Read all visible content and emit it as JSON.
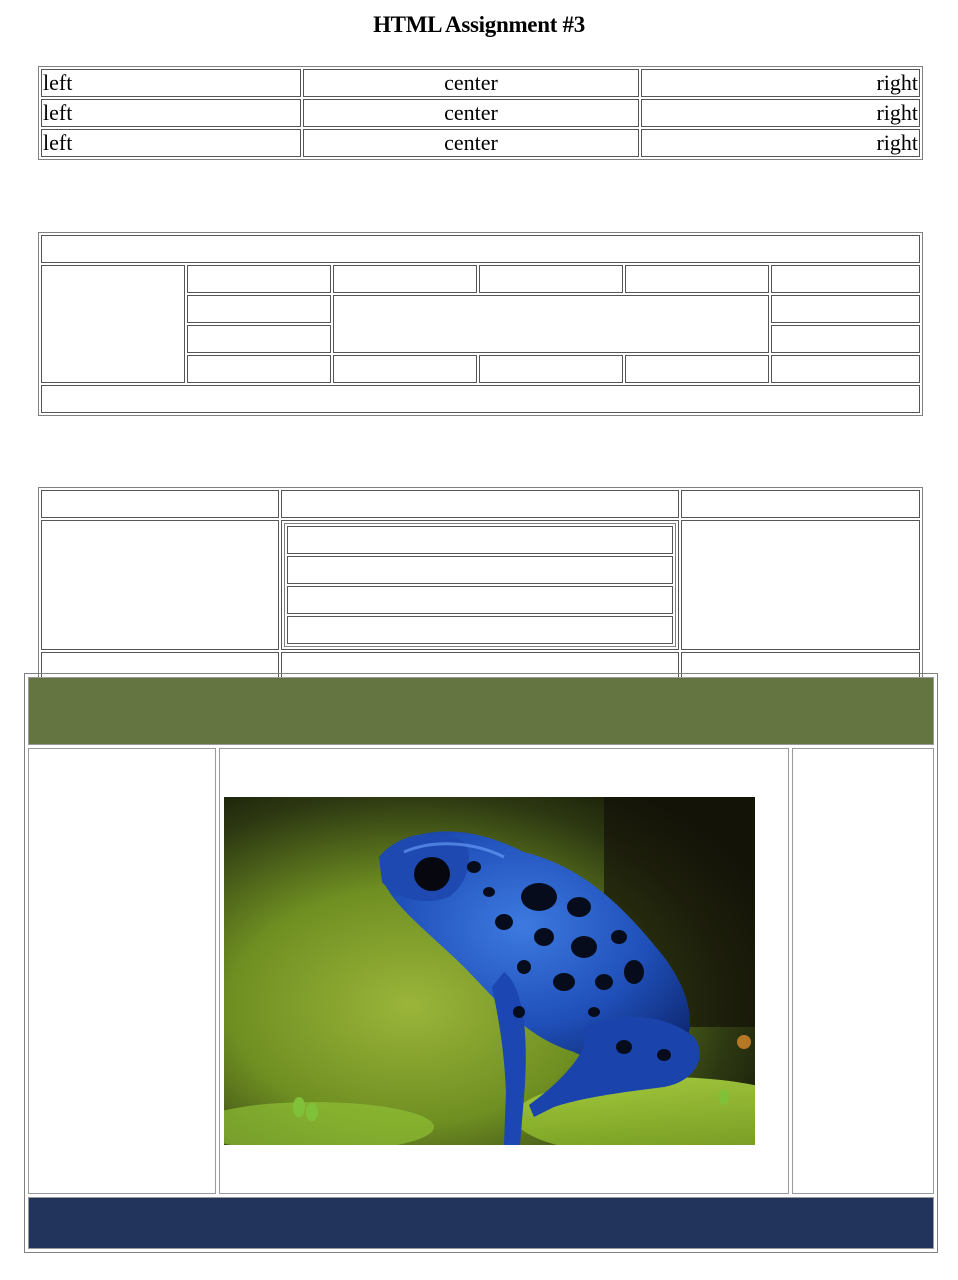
{
  "page": {
    "title": "HTML Assignment #3"
  },
  "alignment_table": {
    "rows": [
      {
        "left": "left",
        "center": "center",
        "right": "right"
      },
      {
        "left": "left",
        "center": "center",
        "right": "right"
      },
      {
        "left": "left",
        "center": "center",
        "right": "right"
      }
    ]
  },
  "layout": {
    "header_color": "#657542",
    "footer_color": "#22345c",
    "image": {
      "subject": "blue poison dart frog",
      "icon": "frog-image"
    }
  }
}
